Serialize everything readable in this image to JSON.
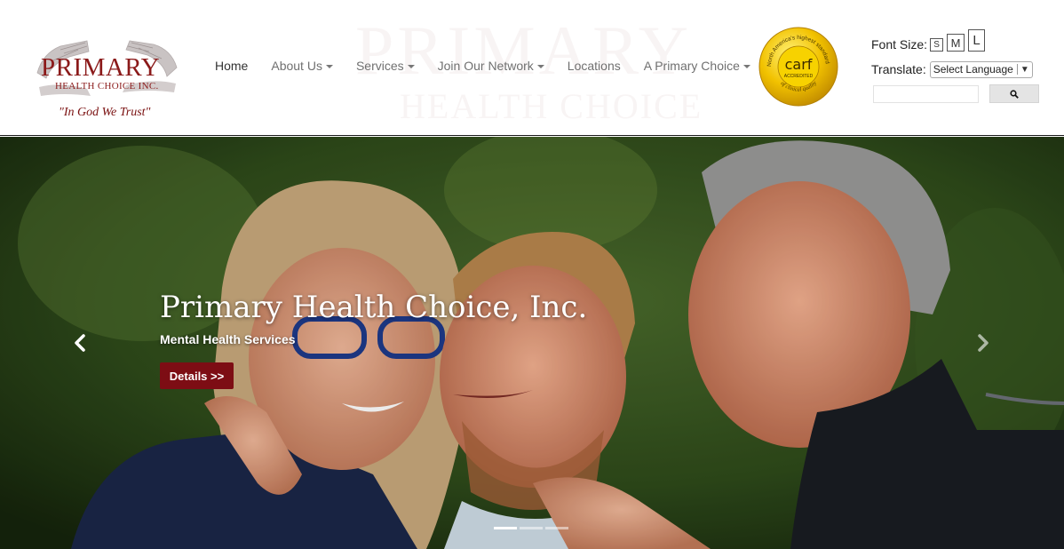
{
  "logo": {
    "name": "PRIMARY",
    "subtitle": "HEALTH CHOICE INC.",
    "motto": "\"In God We Trust\""
  },
  "watermark": {
    "line1": "PRIMARY",
    "line2": "HEALTH CHOICE INC."
  },
  "nav": {
    "items": [
      {
        "label": "Home",
        "dropdown": false,
        "active": true
      },
      {
        "label": "About Us",
        "dropdown": true
      },
      {
        "label": "Services",
        "dropdown": true
      },
      {
        "label": "Join Our Network",
        "dropdown": true
      },
      {
        "label": "Locations",
        "dropdown": false
      },
      {
        "label": "A Primary Choice",
        "dropdown": true
      }
    ]
  },
  "carf_badge": {
    "ring_top": "North America's highest standard",
    "ring_bottom": "of clinical quality",
    "logo": "carf",
    "accredited": "ACCREDITED"
  },
  "tools": {
    "font_size_label": "Font Size:",
    "font_sizes": [
      "S",
      "M",
      "L"
    ],
    "translate_label": "Translate:",
    "language_select": "Select Language",
    "search_value": "",
    "search_icon": "search-icon"
  },
  "hero": {
    "title": "Primary Health Choice, Inc.",
    "subtitle": "Mental Health Services",
    "button_label": "Details >>",
    "prev_icon": "chevron-left-icon",
    "next_icon": "chevron-right-icon",
    "slide_count": 3,
    "active_slide": 1
  },
  "colors": {
    "brand_red": "#8b1a1a",
    "button_red": "#7d0d14",
    "badge_gold": "#f2c200",
    "nav_text": "#707070"
  }
}
